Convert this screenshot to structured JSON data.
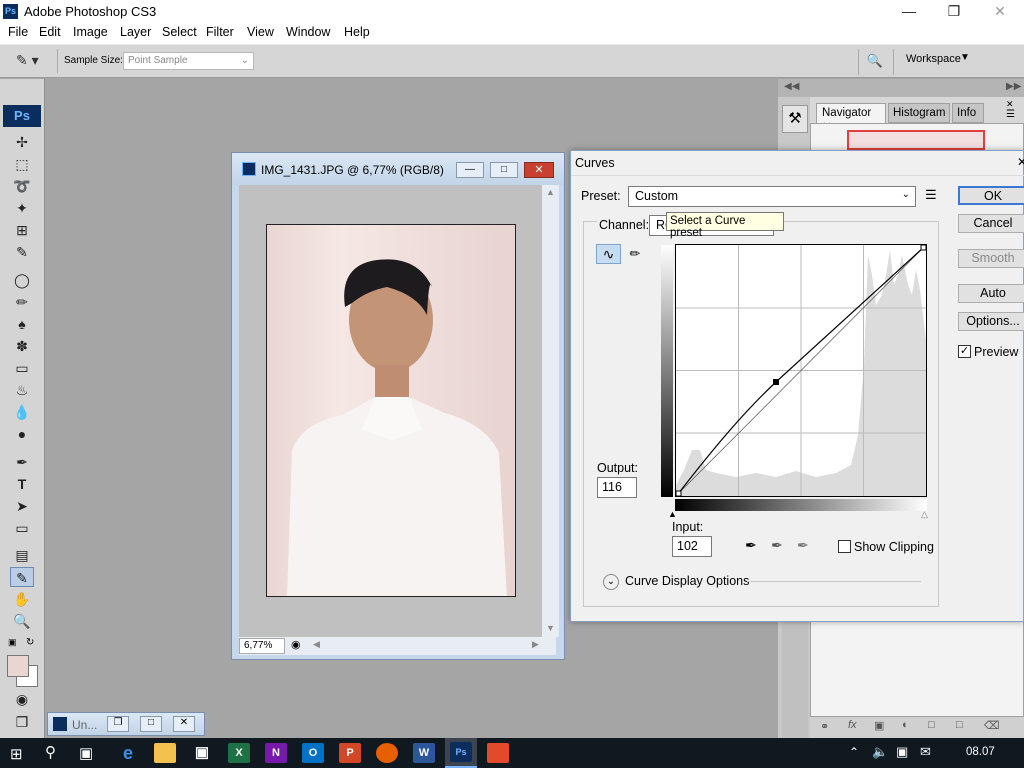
{
  "app": {
    "title": "Adobe Photoshop CS3",
    "logo": "Ps"
  },
  "menu": [
    "File",
    "Edit",
    "Image",
    "Layer",
    "Select",
    "Filter",
    "View",
    "Window",
    "Help"
  ],
  "options_bar": {
    "sample_size_label": "Sample Size:",
    "sample_size_value": "Point Sample",
    "workspace": "Workspace"
  },
  "document": {
    "title": "IMG_1431.JPG @ 6,77% (RGB/8)",
    "zoom": "6,77%"
  },
  "minimized_doc": {
    "title": "Un..."
  },
  "panels": {
    "tabs": [
      "Navigator",
      "Histogram",
      "Info"
    ]
  },
  "curves": {
    "title": "Curves",
    "preset_label": "Preset:",
    "preset_value": "Custom",
    "channel_label": "Channel:",
    "channel_value": "RGB",
    "tooltip": "Select a Curve preset",
    "output_label": "Output:",
    "output_value": "116",
    "input_label": "Input:",
    "input_value": "102",
    "show_clipping": "Show Clipping",
    "display_options": "Curve Display Options",
    "buttons": {
      "ok": "OK",
      "cancel": "Cancel",
      "smooth": "Smooth",
      "auto": "Auto",
      "options": "Options..."
    },
    "preview": "Preview",
    "preview_checked": true
  },
  "taskbar": {
    "time": "08.07"
  },
  "colors": {
    "accent": "#0b2d5e",
    "ps_blue": "#6cb4ff",
    "close_red": "#c8402f"
  }
}
